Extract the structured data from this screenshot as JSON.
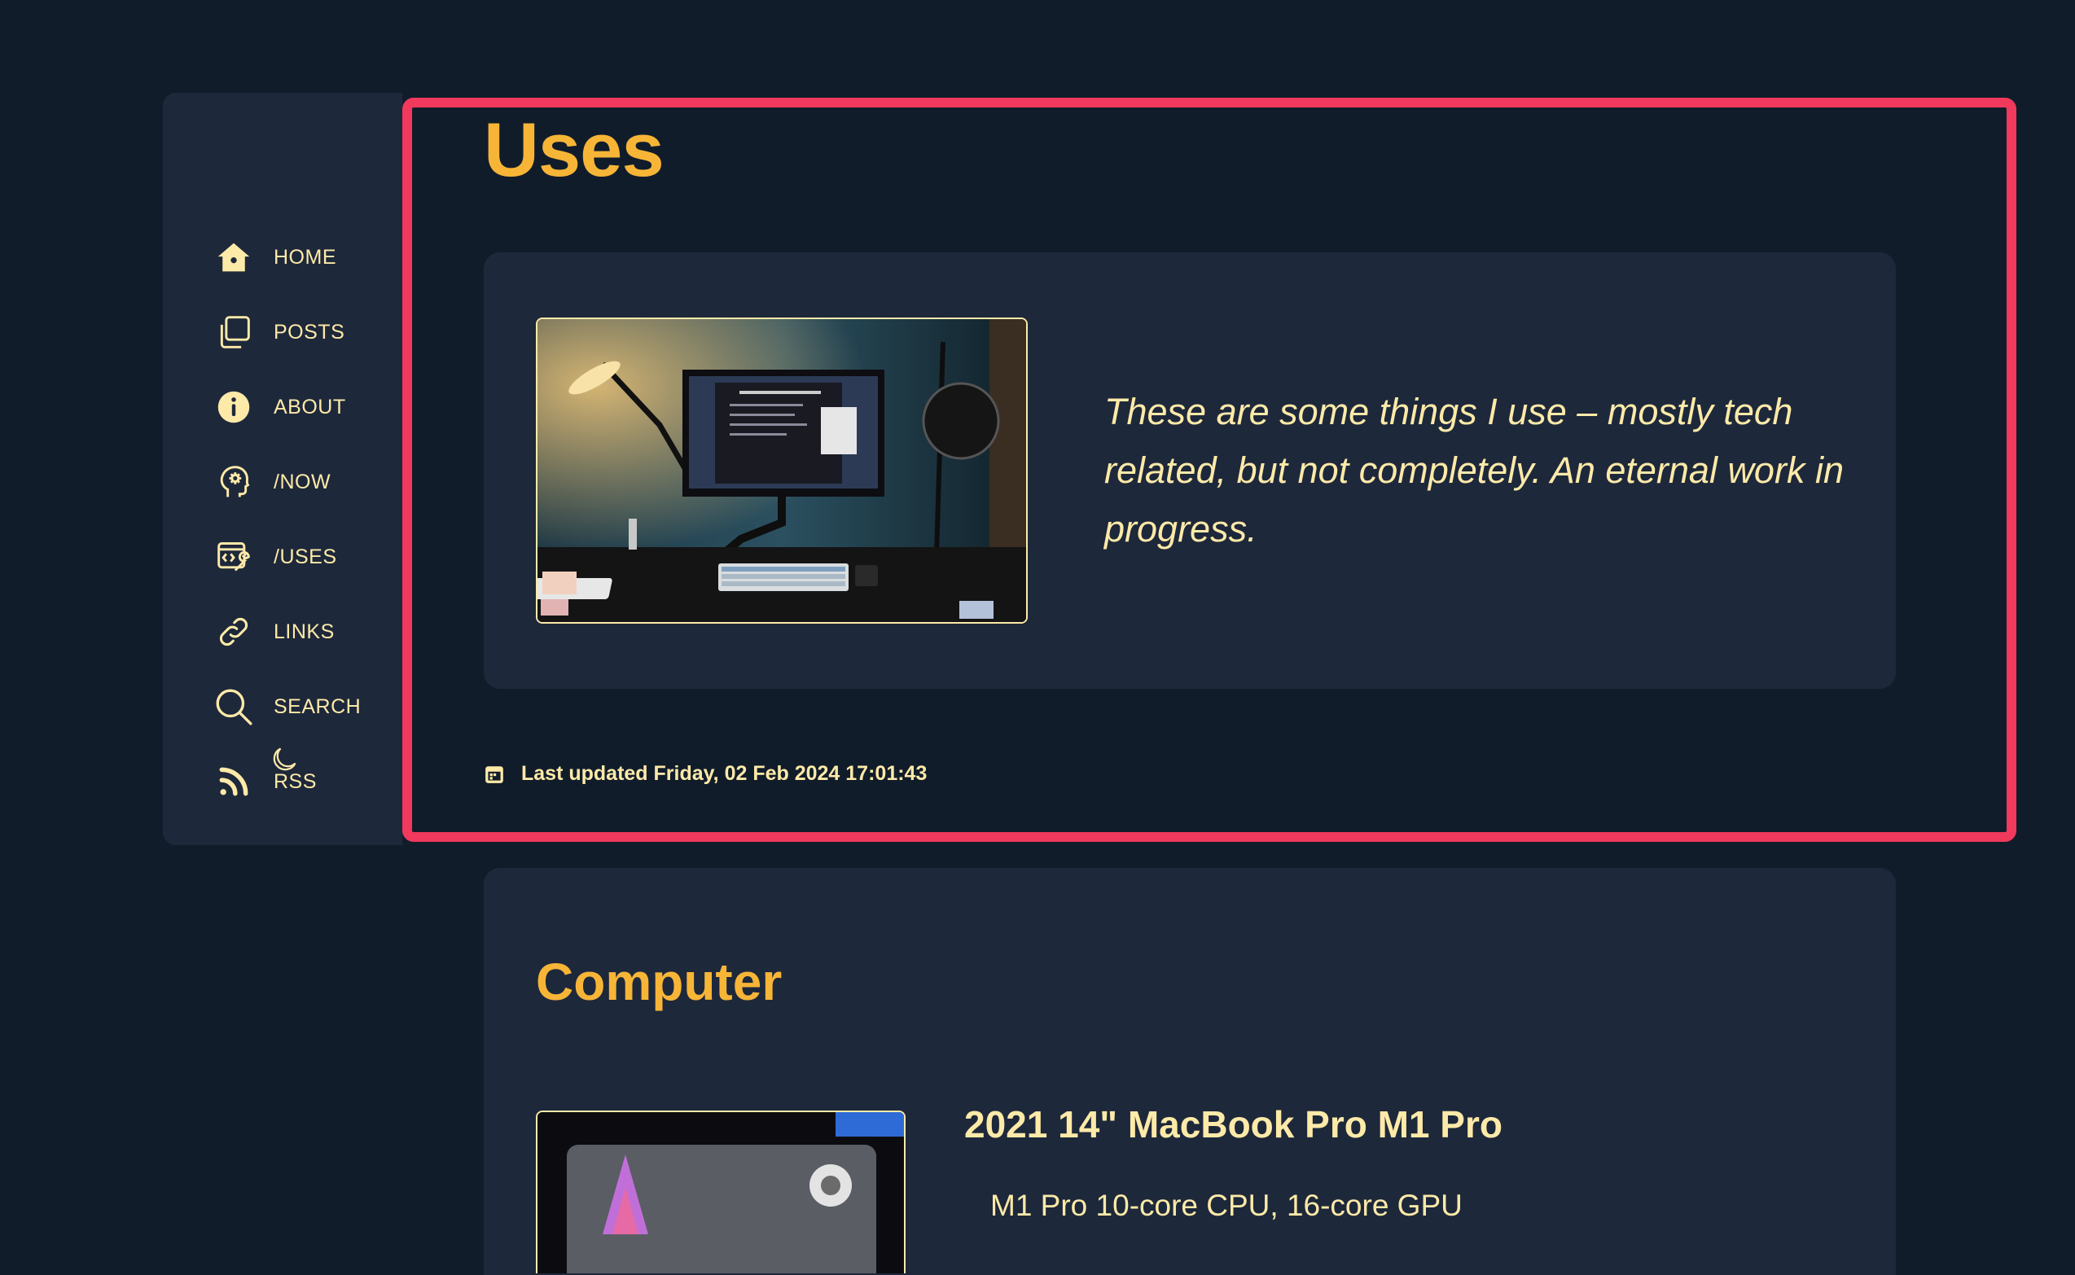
{
  "nav": {
    "items": [
      {
        "label": "HOME",
        "icon": "home-icon"
      },
      {
        "label": "POSTS",
        "icon": "posts-icon"
      },
      {
        "label": "ABOUT",
        "icon": "info-icon"
      },
      {
        "label": "/NOW",
        "icon": "head-gear-icon"
      },
      {
        "label": "/USES",
        "icon": "tools-icon"
      },
      {
        "label": "LINKS",
        "icon": "link-icon"
      },
      {
        "label": "SEARCH",
        "icon": "search-icon"
      },
      {
        "label": "RSS",
        "icon": "rss-icon"
      }
    ],
    "theme_toggle_icon": "moon-icon"
  },
  "page": {
    "title": "Uses",
    "intro": "These are some things I use – mostly tech related, but not completely. An eternal work in progress.",
    "last_updated": "Last updated Friday, 02 Feb 2024 17:01:43"
  },
  "section": {
    "title": "Computer",
    "item_title": "2021 14\" MacBook Pro M1 Pro",
    "item_spec": "M1 Pro 10-core CPU, 16-core GPU"
  },
  "colors": {
    "background": "#111c2b",
    "card": "#1e283b",
    "accent": "#f7b537",
    "text": "#fdeaa8",
    "highlight": "#f0395c"
  }
}
